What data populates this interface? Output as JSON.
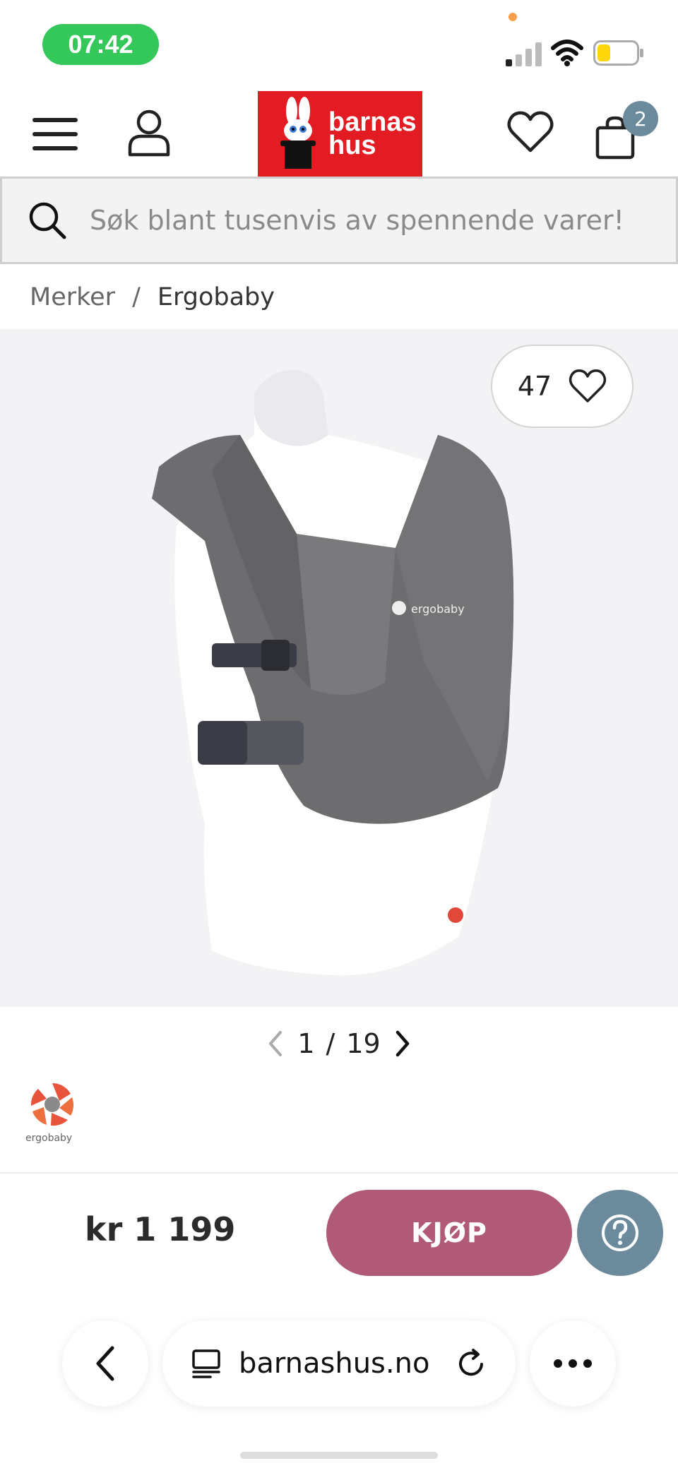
{
  "status_bar": {
    "time": "07:42",
    "battery_color": "#ffd60a",
    "clock_color": "#34c759"
  },
  "header": {
    "logo_line1": "barnas",
    "logo_line2": "hus",
    "cart_count": "2",
    "brand_color": "#e31b23"
  },
  "search": {
    "placeholder": "Søk blant tusenvis av spennende varer!"
  },
  "breadcrumb": {
    "items": [
      "Merker",
      "Ergobaby"
    ],
    "separator": "/"
  },
  "product": {
    "image_alt": "Ergobaby baby carrier, grey",
    "like_count": "47",
    "image_index": "1",
    "image_total": "19",
    "pager_separator": "/",
    "brand_name": "ergobaby"
  },
  "purchase": {
    "price": "kr 1 199",
    "buy_label": "KJØP",
    "buy_color": "#b05a78",
    "help_color": "#6b8a9c"
  },
  "browser": {
    "url": "barnashus.no"
  }
}
